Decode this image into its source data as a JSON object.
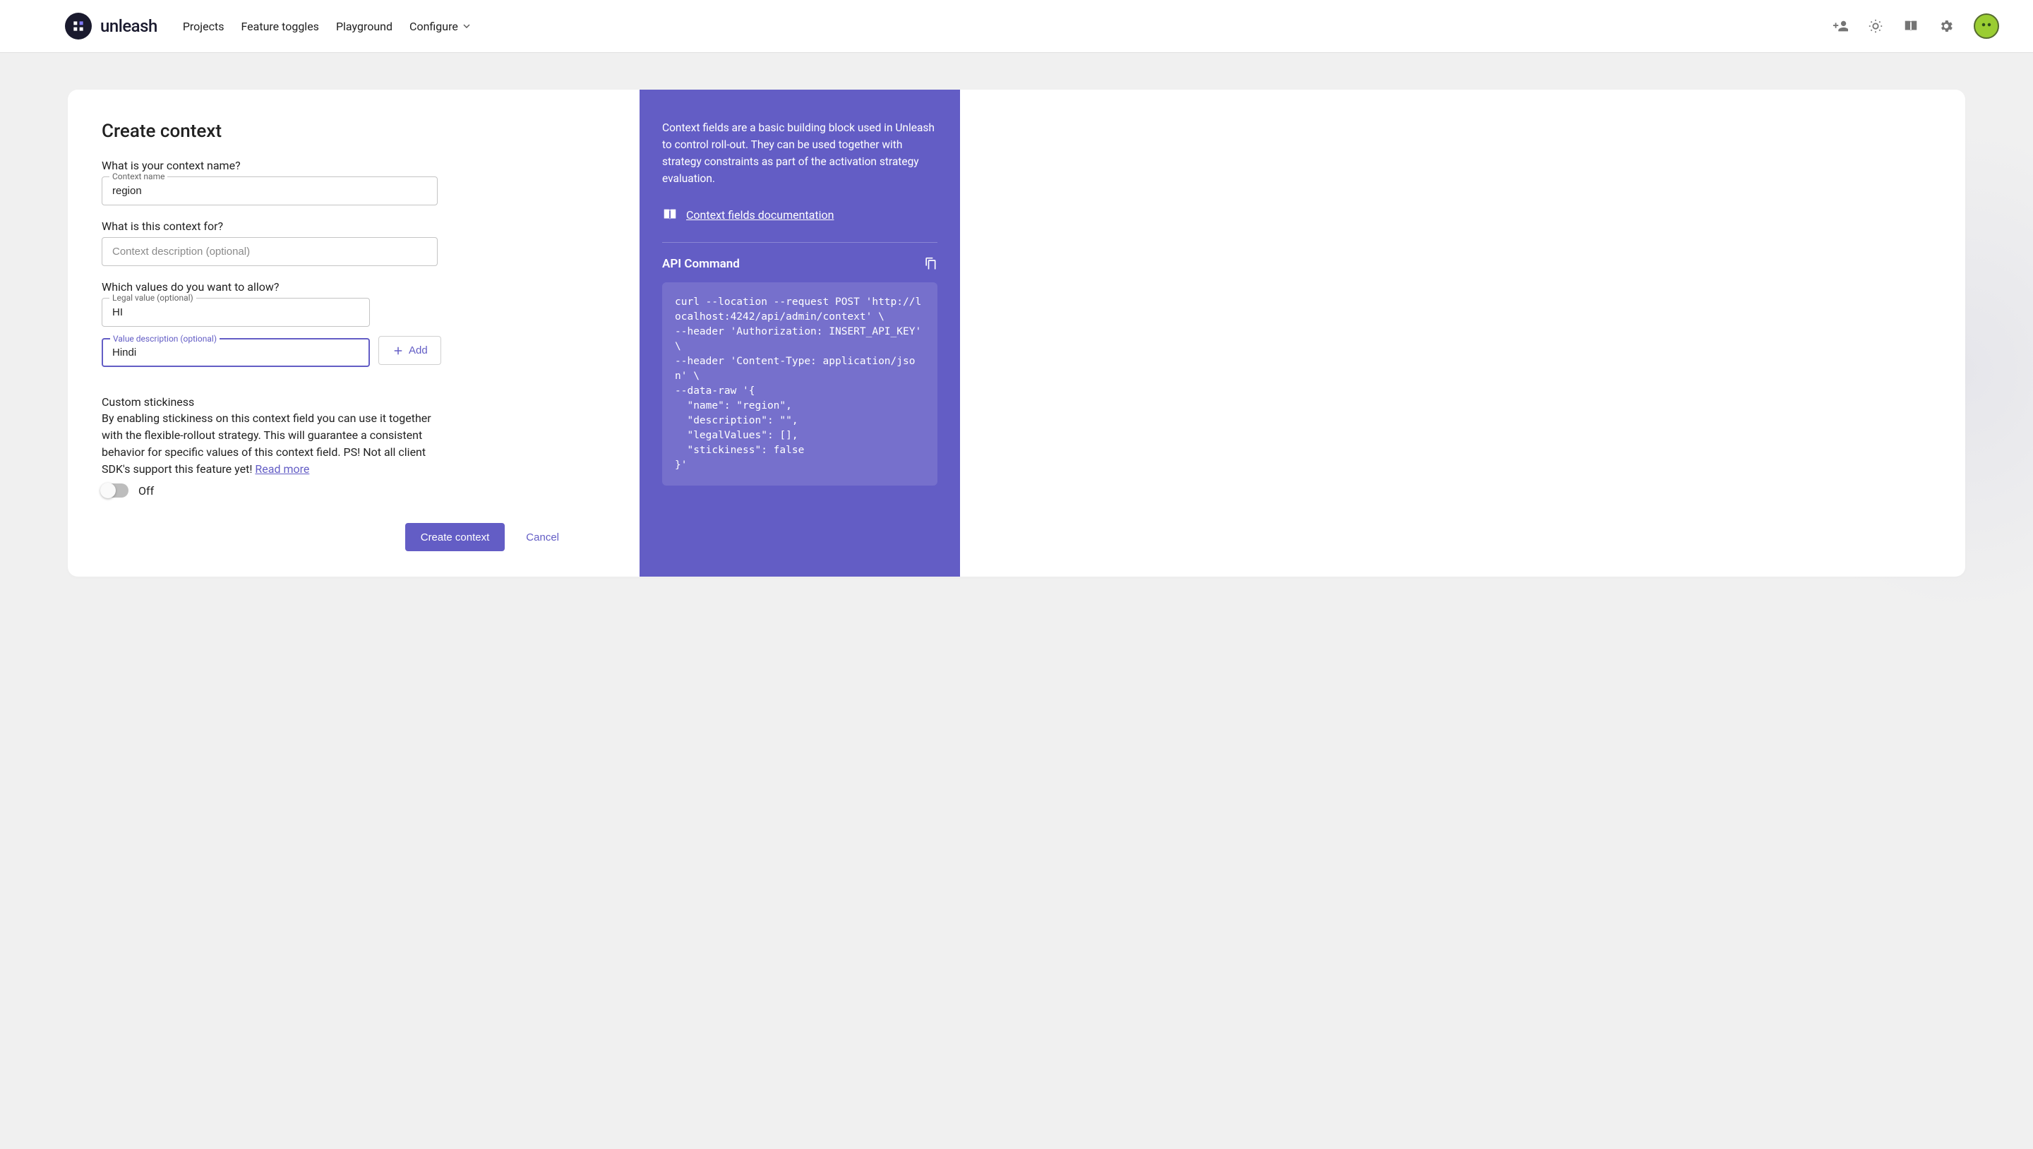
{
  "header": {
    "brand": "unleash",
    "nav": {
      "projects": "Projects",
      "feature_toggles": "Feature toggles",
      "playground": "Playground",
      "configure": "Configure"
    }
  },
  "page": {
    "title": "Create context",
    "name_q": "What is your context name?",
    "name_label": "Context name",
    "name_value": "region",
    "desc_q": "What is this context for?",
    "desc_placeholder": "Context description (optional)",
    "desc_value": "",
    "values_q": "Which values do you want to allow?",
    "legal_label": "Legal value (optional)",
    "legal_value": "HI",
    "value_desc_label": "Value description (optional)",
    "value_desc_value": "Hindi",
    "add_label": "Add",
    "stickiness_h": "Custom stickiness",
    "stickiness_p": "By enabling stickiness on this context field you can use it together with the flexible-rollout strategy. This will guarantee a consistent behavior for specific values of this context field. PS! Not all client SDK's support this feature yet! ",
    "read_more": "Read more",
    "toggle_label": "Off",
    "submit": "Create context",
    "cancel": "Cancel"
  },
  "info": {
    "p": "Context fields are a basic building block used in Unleash to control roll-out. They can be used together with strategy constraints as part of the activation strategy evaluation.",
    "doc_link": "Context fields documentation",
    "api_h": "API Command",
    "code": "curl --location --request POST 'http://localhost:4242/api/admin/context' \\\n--header 'Authorization: INSERT_API_KEY' \\\n--header 'Content-Type: application/json' \\\n--data-raw '{\n  \"name\": \"region\",\n  \"description\": \"\",\n  \"legalValues\": [],\n  \"stickiness\": false\n}'"
  }
}
